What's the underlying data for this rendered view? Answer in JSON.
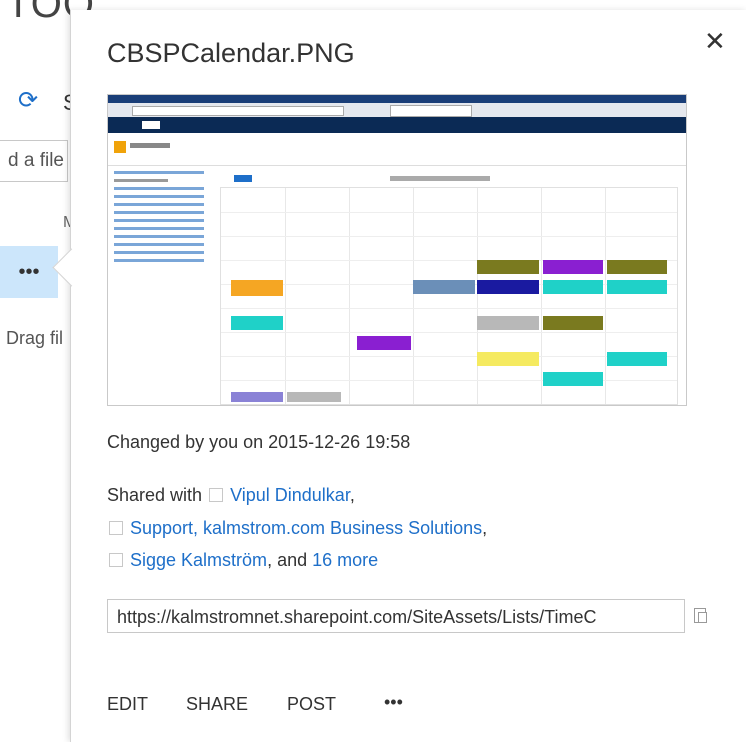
{
  "background": {
    "title_fragment": "TOO",
    "sync_fragment": "S",
    "add_file_fragment": "d a file",
    "column_fragment": "M",
    "ellipsis": "•••",
    "drag_fragment": "Drag fil"
  },
  "callout": {
    "file_name": "CBSPCalendar.PNG",
    "close_glyph": "✕",
    "changed": "Changed by you on 2015-12-26 19:58",
    "shared_prefix": "Shared with",
    "shared_people": [
      {
        "name": "Vipul Dindulkar",
        "sep": ","
      },
      {
        "name": "Support, kalmstrom.com Business Solutions",
        "sep": ","
      },
      {
        "name": "Sigge Kalmström",
        "sep": ", and"
      }
    ],
    "more_link": "16 more",
    "link_url": "https://kalmstromnet.sharepoint.com/SiteAssets/Lists/TimeC",
    "actions": {
      "edit": "EDIT",
      "share": "SHARE",
      "post": "POST",
      "more": "•••"
    }
  },
  "colors": {
    "accent": "#1e6fc9",
    "selected_bg": "#cce6fb",
    "event_orange": "#f5a623",
    "event_teal": "#1fd1c8",
    "event_purple": "#8a1fd1",
    "event_navy": "#1a1aa0",
    "event_olive": "#7a7a1f",
    "event_yellow": "#f5ea60",
    "event_gray": "#b8b8b8",
    "event_lavender": "#8a82d6",
    "event_steel": "#6b8fb8"
  }
}
